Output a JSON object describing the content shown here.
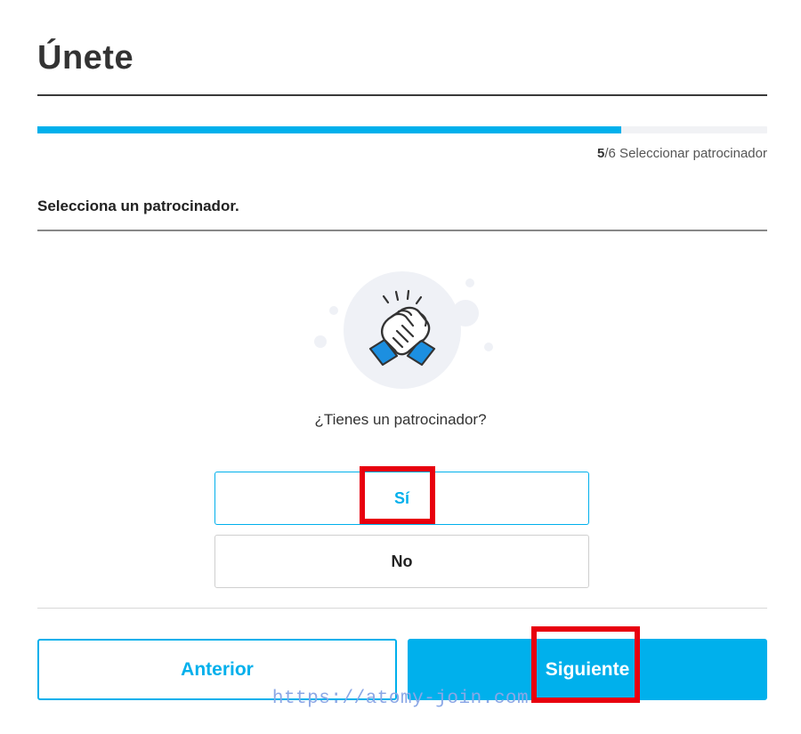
{
  "header": {
    "title": "Únete"
  },
  "progress": {
    "current": "5",
    "total": "/6",
    "step_name": " Seleccionar patrocinador",
    "fraction": 0.8
  },
  "section": {
    "title": "Selecciona un patrocinador."
  },
  "illustration": {
    "icon": "handshake-icon",
    "circle_color": "#eff1f6",
    "accent_color": "#1c8fe0"
  },
  "question": {
    "text": "¿Tienes un patrocinador?"
  },
  "options": {
    "yes_label": "Sí",
    "no_label": "No"
  },
  "footer": {
    "prev_label": "Anterior",
    "next_label": "Siguiente"
  },
  "watermark": {
    "text": "https://atomy-join.com"
  },
  "colors": {
    "accent": "#00b0ec",
    "highlight": "#e8000e"
  }
}
